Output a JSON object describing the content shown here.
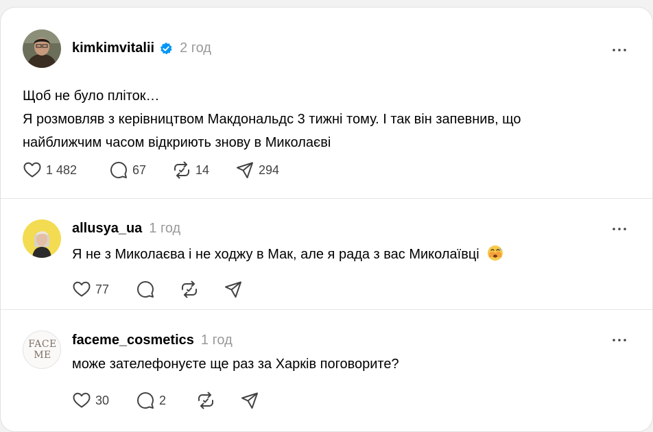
{
  "post": {
    "username": "kimkimvitalii",
    "time": "2 год",
    "lines": [
      "Щоб не було пліток…",
      "Я розмовляв з керівництвом Макдональдс 3 тижні тому. І так він запевнив, що",
      "найближчим часом відкриють знову в Миколаєві"
    ],
    "likes": "1 482",
    "comments": "67",
    "reposts": "14",
    "shares": "294"
  },
  "replies": [
    {
      "username": "allusya_ua",
      "time": "1 год",
      "text": "Я не з Миколаєва і не ходжу в Мак, але я рада з вас Миколаївці",
      "emoji": "hot-face-emoji",
      "likes": "77",
      "comments": "",
      "reposts": ""
    },
    {
      "username": "faceme_cosmetics",
      "time": "1 год",
      "text": "може зателефонуєте ще раз за Харків поговорите?",
      "likes": "30",
      "comments": "2",
      "reposts": "",
      "avatar_logo_line1": "FACE",
      "avatar_logo_line2": "ME"
    }
  ],
  "colors": {
    "verified": "#0095f6",
    "muted": "#999999",
    "icon": "#424242"
  },
  "icons": [
    "heart-icon",
    "comment-icon",
    "repost-icon",
    "share-icon",
    "more-icon",
    "verified-badge-icon"
  ]
}
